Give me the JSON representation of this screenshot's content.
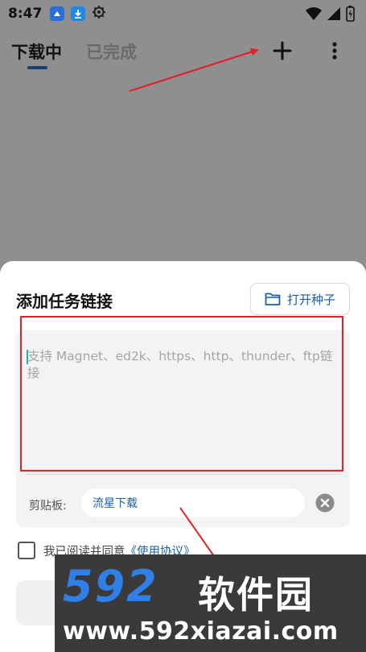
{
  "status_bar": {
    "time": "8:47",
    "icons": [
      "app-icon",
      "download-icon",
      "gear-icon",
      "wifi-icon",
      "signal-icon",
      "battery-icon"
    ]
  },
  "header": {
    "tabs": [
      {
        "label": "下载中",
        "active": true
      },
      {
        "label": "已完成",
        "active": false
      }
    ],
    "actions": [
      "plus-icon",
      "more-vert-icon"
    ]
  },
  "sheet": {
    "title": "添加任务链接",
    "open_seed_label": "打开种子",
    "input": {
      "value": "",
      "placeholder": "支持 Magnet、ed2k、https、http、thunder、ftp链接"
    },
    "clipboard": {
      "label": "剪贴板:",
      "value": "流星下载"
    },
    "agreement": {
      "text": "我已阅读并同意",
      "link": "《使用协议》",
      "checked": false
    }
  },
  "watermark": {
    "logo": "592",
    "name": "软件园",
    "url": "www.592xiazai.com"
  },
  "colors": {
    "accent": "#1a5fa8",
    "annotation": "#e0222d",
    "overlay": "#8f8f8f",
    "watermark_blue": "#2f7fe6"
  }
}
